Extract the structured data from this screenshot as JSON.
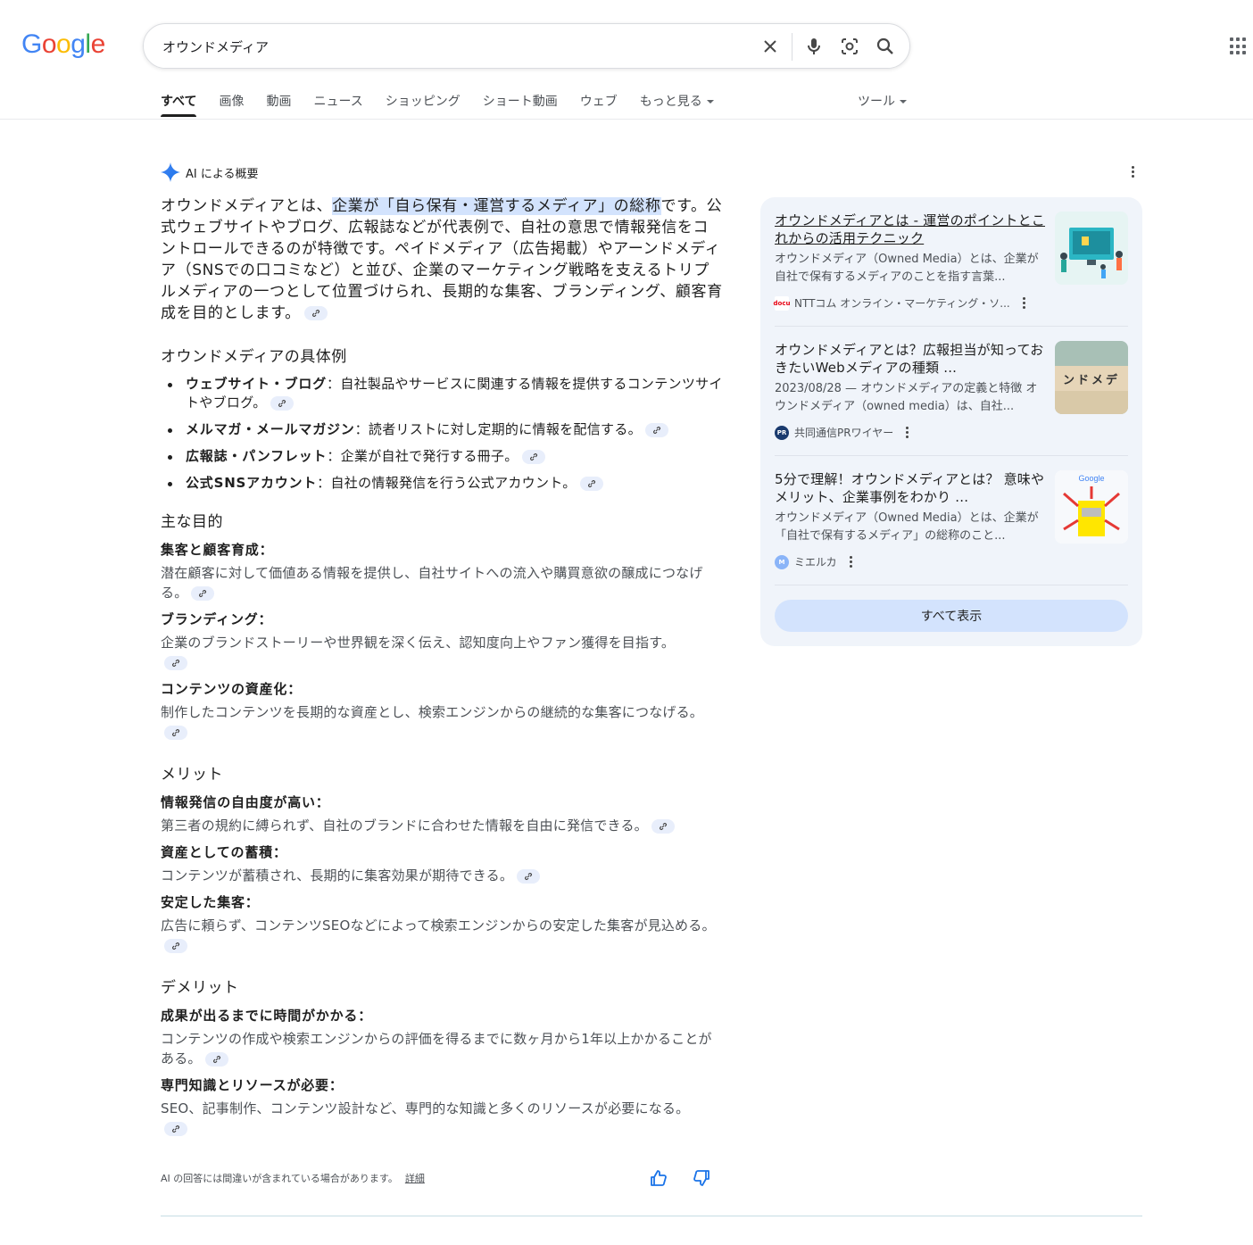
{
  "header": {
    "logo": {
      "G": "G",
      "o1": "o",
      "o2": "o",
      "g": "g",
      "l": "l",
      "e": "e"
    },
    "search": {
      "query": "オウンドメディア"
    },
    "tabs": [
      "すべて",
      "画像",
      "動画",
      "ニュース",
      "ショッピング",
      "ショート動画",
      "ウェブ",
      "もっと見る"
    ],
    "tools_label": "ツール"
  },
  "ai_overview": {
    "heading": "AI による概要",
    "lead": {
      "pre": "オウンドメディアとは、",
      "highlight": "企業が「自ら保有・運営するメディア」の総称",
      "post": "です。公式ウェブサイトやブログ、広報誌などが代表例で、自社の意思で情報発信をコントロールできるのが特徴です。ペイドメディア（広告掲載）やアーンドメディア（SNSでの口コミなど）と並び、企業のマーケティング戦略を支えるトリプルメディアの一つとして位置づけられ、長期的な集客、ブランディング、顧客育成を目的とします。"
    },
    "examples": {
      "heading": "オウンドメディアの具体例",
      "items": [
        {
          "term": "ウェブサイト・ブログ",
          "desc": "自社製品やサービスに関連する情報を提供するコンテンツサイトやブログ。"
        },
        {
          "term": "メルマガ・メールマガジン",
          "desc": "読者リストに対し定期的に情報を配信する。"
        },
        {
          "term": "広報誌・パンフレット",
          "desc": "企業が自社で発行する冊子。"
        },
        {
          "term": "公式SNSアカウント",
          "desc": "自社の情報発信を行う公式アカウント。"
        }
      ]
    },
    "purposes": {
      "heading": "主な目的",
      "items": [
        {
          "term": "集客と顧客育成：",
          "desc": "潜在顧客に対して価値ある情報を提供し、自社サイトへの流入や購買意欲の醸成につなげる。"
        },
        {
          "term": "ブランディング：",
          "desc": "企業のブランドストーリーや世界観を深く伝え、認知度向上やファン獲得を目指す。"
        },
        {
          "term": "コンテンツの資産化：",
          "desc": "制作したコンテンツを長期的な資産とし、検索エンジンからの継続的な集客につなげる。"
        }
      ]
    },
    "merits": {
      "heading": "メリット",
      "items": [
        {
          "term": "情報発信の自由度が高い：",
          "desc": "第三者の規約に縛られず、自社のブランドに合わせた情報を自由に発信できる。"
        },
        {
          "term": "資産としての蓄積：",
          "desc": "コンテンツが蓄積され、長期的に集客効果が期待できる。"
        },
        {
          "term": "安定した集客：",
          "desc": "広告に頼らず、コンテンツSEOなどによって検索エンジンからの安定した集客が見込める。"
        }
      ]
    },
    "demerits": {
      "heading": "デメリット",
      "items": [
        {
          "term": "成果が出るまでに時間がかかる：",
          "desc": "コンテンツの作成や検索エンジンからの評価を得るまでに数ヶ月から1年以上かかることがある。"
        },
        {
          "term": "専門知識とリソースが必要：",
          "desc": "SEO、記事制作、コンテンツ設計など、専門的な知識と多くのリソースが必要になる。"
        }
      ]
    },
    "disclaimer": "AI の回答には間違いが含まれている場合があります。",
    "details_link": "詳細"
  },
  "sources": {
    "items": [
      {
        "title": "オウンドメディアとは - 運営のポイントとこれからの活用テクニック",
        "snippet": "オウンドメディア（Owned Media）とは、企業が自社で保有するメディアのことを指す言葉...",
        "site": "NTTコム オンライン・マーケティング・ソ...",
        "fav_text": "docu",
        "fav_color": "#e60012"
      },
      {
        "title": "オウンドメディアとは？広報担当が知っておきたいWebメディアの種類 ...",
        "snippet": "2023/08/28 — オウンドメディアの定義と特徴 オウンドメディア（owned media）は、自社...",
        "site": "共同通信PRワイヤー",
        "fav_text": "PR",
        "fav_color": "#1a3a6e",
        "image_text": "ンドメデ"
      },
      {
        "title": "5分で理解！オウンドメディアとは？ 意味やメリット、企業事例をわかり ...",
        "snippet": "オウンドメディア（Owned Media）とは、企業が「自社で保有するメディア」の総称のこと...",
        "site": "ミエルカ",
        "fav_text": "M",
        "fav_color": "#8ab4f8",
        "image_text": "Google"
      }
    ],
    "show_all": "すべて表示"
  },
  "colors": {
    "accent": "#1a73e8",
    "highlight": "#d3e3fd",
    "card_bg": "#f0f4fa"
  }
}
